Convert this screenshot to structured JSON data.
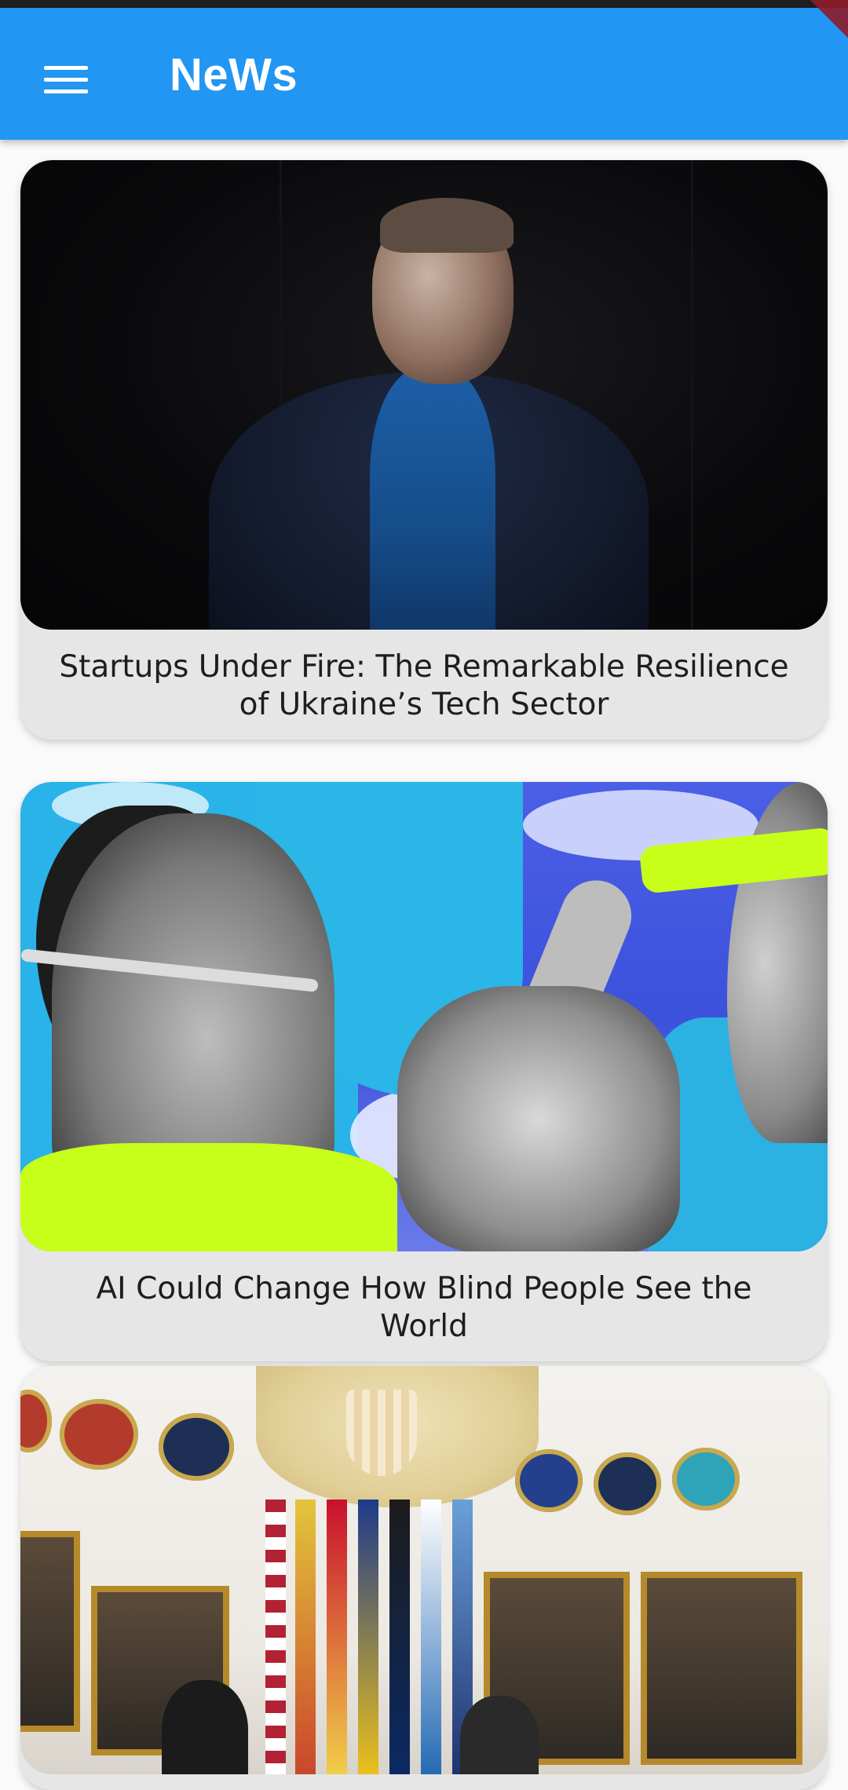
{
  "app": {
    "title": "NeWs",
    "menu_icon": "menu-icon"
  },
  "articles": [
    {
      "title": "Startups Under Fire: The Remarkable Resilience of Ukraine’s Tech Sector",
      "image": "portrait-photo"
    },
    {
      "title": "AI Could Change How Blind People See the World",
      "image": "collage-illustration"
    },
    {
      "title": "",
      "image": "hearing-room-photo"
    }
  ],
  "colors": {
    "appbar": "#2196f3",
    "card": "#e6e6e6",
    "background": "#fafafa"
  }
}
